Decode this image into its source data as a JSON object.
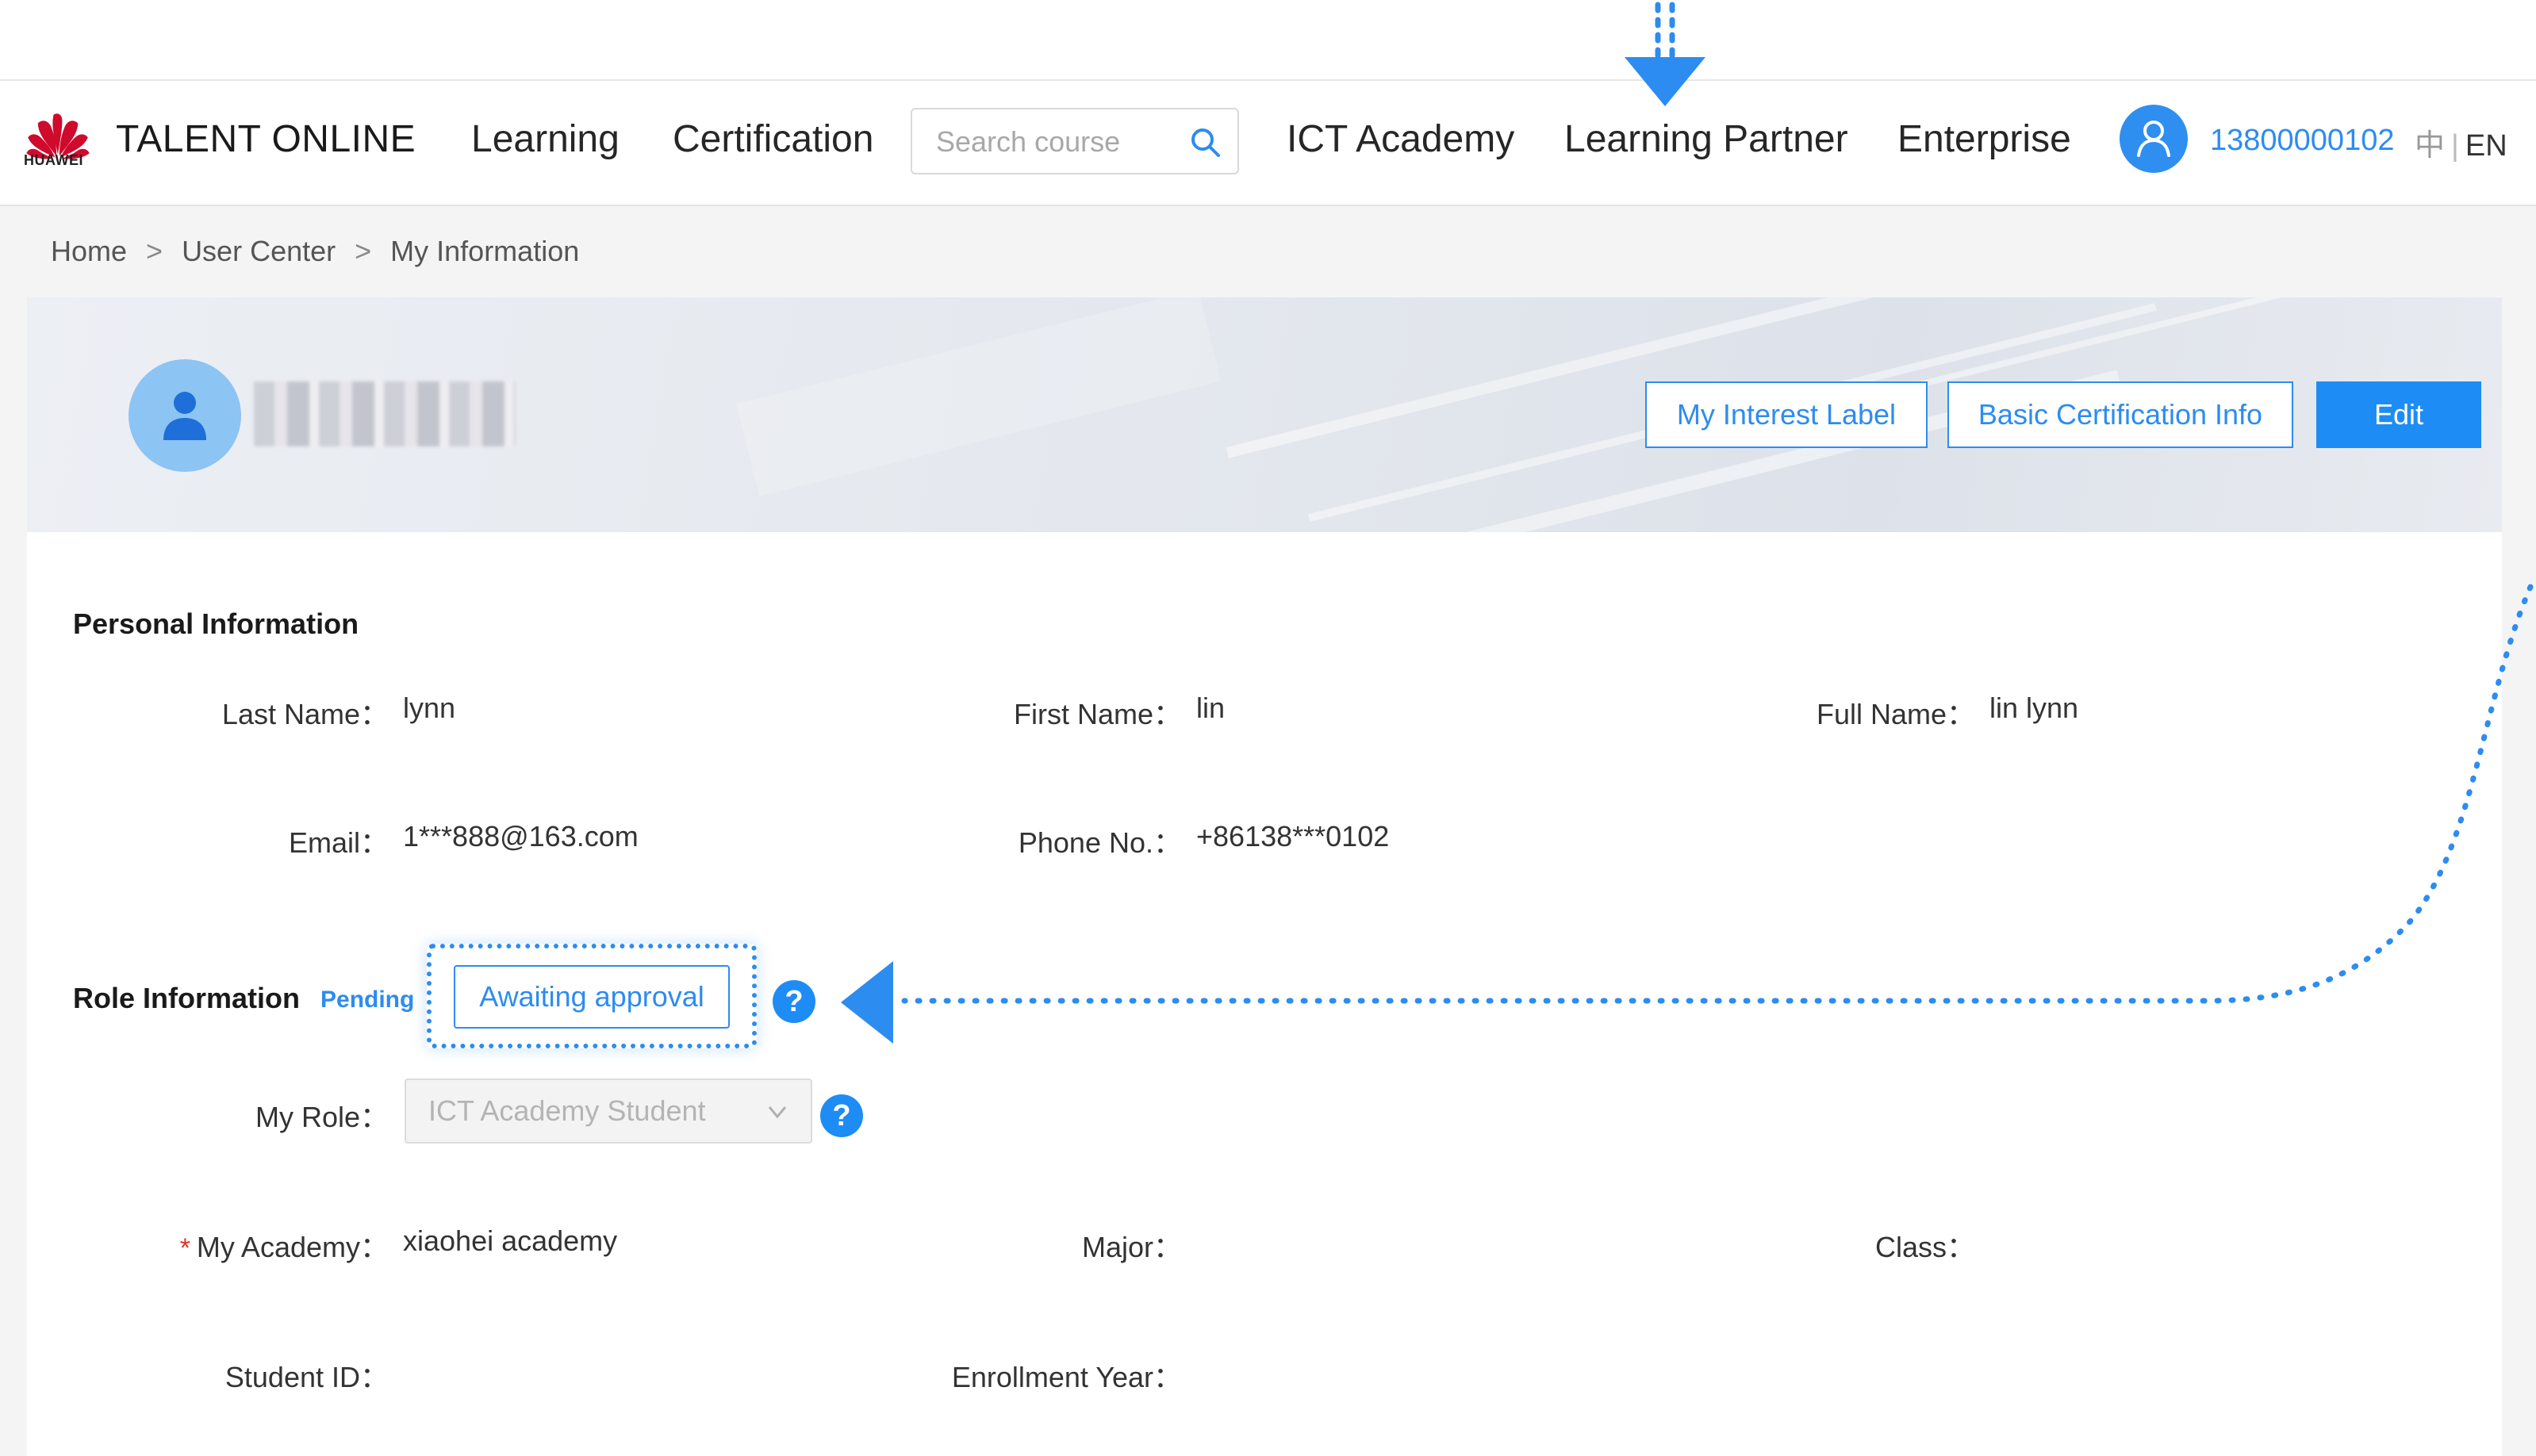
{
  "header": {
    "logo_brand": "HUAWEI",
    "brand": "TALENT ONLINE",
    "nav": [
      "Learning",
      "Certification",
      "ICT Academy",
      "Learning Partner",
      "Enterprise"
    ],
    "search_placeholder": "Search course",
    "phone": "13800000102",
    "lang_cn": "中",
    "lang_en": "EN"
  },
  "breadcrumb": [
    "Home",
    "User Center",
    "My Information"
  ],
  "banner": {
    "buttons": {
      "interest": "My Interest Label",
      "basic_cert": "Basic Certification Info",
      "edit": "Edit"
    }
  },
  "personal": {
    "title": "Personal Information",
    "last_name_label": "Last Name：",
    "last_name": "lynn",
    "first_name_label": "First Name：",
    "first_name": "lin",
    "full_name_label": "Full Name：",
    "full_name": "lin lynn",
    "email_label": "Email：",
    "email": "1***888@163.com",
    "phone_label": "Phone No.：",
    "phone": "+86138***0102"
  },
  "role": {
    "title": "Role Information",
    "status": "Pending",
    "awaiting": "Awaiting approval",
    "help": "?",
    "my_role_label": "My Role：",
    "my_role": "ICT Academy Student",
    "academy_required": "*",
    "academy_label": "My Academy：",
    "academy": "xiaohei academy",
    "major_label": "Major：",
    "class_label": "Class：",
    "student_id_label": "Student ID：",
    "enrollment_label": "Enrollment Year："
  },
  "colors": {
    "accent": "#2d8cf0",
    "primary_button": "#1e8cf5",
    "huawei_red": "#cf0a2c"
  }
}
